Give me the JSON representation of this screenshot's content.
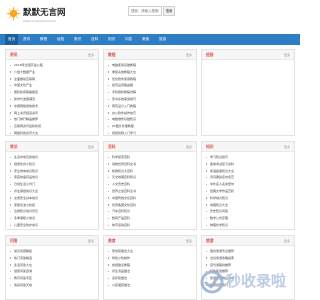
{
  "brand": {
    "title": "默默无言网",
    "subtitle": "www.mmwyhand.com"
  },
  "search": {
    "placeholder": "搜索：请输入搜索词语",
    "button_label": "搜索"
  },
  "nav": {
    "items": [
      {
        "label": "首页"
      },
      {
        "label": "资讯"
      },
      {
        "label": "教程"
      },
      {
        "label": "经验"
      },
      {
        "label": "常识"
      },
      {
        "label": "百科"
      },
      {
        "label": "知识"
      },
      {
        "label": "问答"
      },
      {
        "label": "美食"
      },
      {
        "label": "旅游"
      }
    ],
    "active_index": 0
  },
  "panels": [
    {
      "title": "资讯",
      "more": "更多",
      "items": [
        "2018年全国高速公路",
        "介绍大数据产业",
        "全面推动互联网",
        "中国文化产业",
        "国际新闻联播报道",
        "新时代发展潮流",
        "中国网络通信技术",
        "网上资讯频道资讯",
        "热门排行精品推荐",
        "互联网资讯最新新闻",
        "网络科技资讯大全",
        "热点新闻头条资讯"
      ]
    },
    {
      "title": "教程",
      "more": "更多",
      "items": [
        "电脑使用基础教程",
        "重装系统教程大全",
        "优化软件使用教程",
        "如何设置路由器",
        "手机刷机教程详解",
        "安卓系统使用技巧",
        "网页设计入门教程",
        "办公软件操作技巧",
        "电脑维修基础知识",
        "PS图片处理教程",
        "视频剪辑入门学习",
        "编程开发技术教程"
      ]
    },
    {
      "title": "经验",
      "more": "更多",
      "items": []
    },
    {
      "title": "常识",
      "more": "更多",
      "items": [
        "生活中常见的常识",
        "健康饮食小知识",
        "安全用电常识知识",
        "家庭常备药品常识",
        "日常生活小窍门",
        "养生保健常识大全",
        "交通安全基本常识",
        "家居清洁小妙招",
        "急救知识常识普及",
        "冬季保暖小常识",
        "儿童安全防护常识",
        "节约能源生活常识"
      ]
    },
    {
      "title": "百科",
      "more": "更多",
      "items": [
        "科学探索百科",
        "动物世界百科全书",
        "植物知识大百科",
        "天文地理百科知识",
        "人文历史百科",
        "世界之最百科全书",
        "中国传统文化百科",
        "世界各国文化百科",
        "汽车百科知识",
        "数码产品百科",
        "体育运动百科",
        "军事百科知识"
      ]
    },
    {
      "title": "知识",
      "more": "更多",
      "items": [
        "学习知识技巧",
        "各类考试复习资料",
        "成语故事知识大全",
        "诗词歌赋名句鉴赏",
        "中外名人名言警句",
        "经典文学作品赏析",
        "科学常识知识",
        "地理知识大全",
        "历史知识问答",
        "数学公式定理",
        "物理化学知识",
        "英语学习方法"
      ]
    },
    {
      "title": "问答",
      "more": "更多",
      "items": [
        "常见问题解答",
        "热门问答精选",
        "生活问答大全",
        "健康问答咨询",
        "教育问答专区",
        "情感问答天地"
      ]
    },
    {
      "title": "美食",
      "more": "更多",
      "items": [
        "家常菜做法大全",
        "特色小吃制作",
        "烘焙甜点教程",
        "养生汤品做法",
        "凉拌菜做法",
        "川菜湘菜做法"
      ]
    },
    {
      "title": "旅游",
      "more": "更多",
      "items": [
        "国内旅游景点推荐",
        "出境旅游攻略指南",
        "自驾游路线推荐",
        "特色民宿推荐",
        "旅游必备物品清单",
        "旅游摄影技巧"
      ]
    }
  ],
  "watermark": {
    "text": "秒收录啦"
  }
}
